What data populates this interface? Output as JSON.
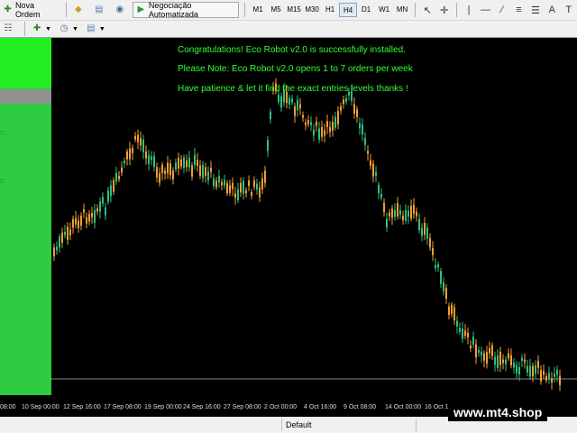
{
  "toolbar": {
    "new_order_label": "Nova Ordem",
    "autotrading_label": "Negociação Automatizada",
    "timeframes": [
      "M1",
      "M5",
      "M15",
      "M30",
      "H1",
      "H4",
      "D1",
      "W1",
      "MN"
    ],
    "active_timeframe": "H4",
    "text_tool_label": "A",
    "label_tool_label": "T"
  },
  "chart": {
    "messages": [
      "Congratulations! Eco Robot v2.0 is successfully installed.",
      "Please Note: Eco Robot v2.0 opens 1 to 7 orders per week",
      "Have patience & let it find the exact entries levels thanks !"
    ],
    "message_color": "#33ff33",
    "bull_color": "#2ec27e",
    "bear_color": "#f0a030",
    "time_labels": [
      "08:00",
      "10 Sep 00:00",
      "12 Sep 16:00",
      "17 Sep 08:00",
      "19 Sep 00:00",
      "24 Sep 16:00",
      "27 Sep 08:00",
      "2 Oct 00:00",
      "4 Oct 16:00",
      "9 Oct 08:00",
      "14 Oct 00:00",
      "16 Oct 16:00"
    ]
  },
  "panel": {
    "color": "#2ecc40",
    "marks": [
      "=",
      "o"
    ]
  },
  "status": {
    "profile": "Default"
  },
  "watermark": "www.mt4.shop"
}
